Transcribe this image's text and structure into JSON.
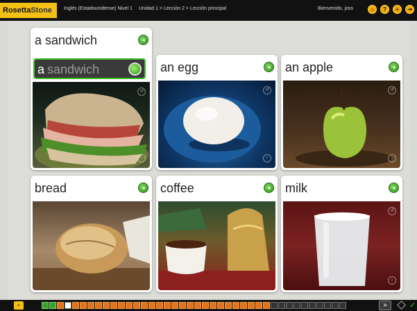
{
  "app": {
    "logo_part1": "Rosetta",
    "logo_part2": "Stone",
    "course": "Inglés (Estadounidense) Nivel 1",
    "breadcrumb": "Unidad 1 > Lección 2 > Lección principal",
    "welcome": "Bienvenido, joss"
  },
  "top_icons": [
    {
      "name": "home-icon",
      "glyph": "⌂"
    },
    {
      "name": "help-icon",
      "glyph": "?"
    },
    {
      "name": "settings-icon",
      "glyph": "≡"
    },
    {
      "name": "exit-icon",
      "glyph": "⇥"
    }
  ],
  "answer": {
    "typed": "a",
    "ghost": "sandwich"
  },
  "cards": [
    {
      "word": "a sandwich",
      "image": "sandwich"
    },
    {
      "word": "an egg",
      "image": "egg"
    },
    {
      "word": "an apple",
      "image": "apple"
    },
    {
      "word": "bread",
      "image": "bread"
    },
    {
      "word": "coffee",
      "image": "coffee"
    },
    {
      "word": "milk",
      "image": "milk"
    }
  ],
  "nav": {
    "next_label": "»",
    "zoom_label": "⌕"
  },
  "colors": {
    "logo": "#f3c116",
    "accent_green": "#3fbf2a",
    "progress_done": "#e2731c"
  }
}
